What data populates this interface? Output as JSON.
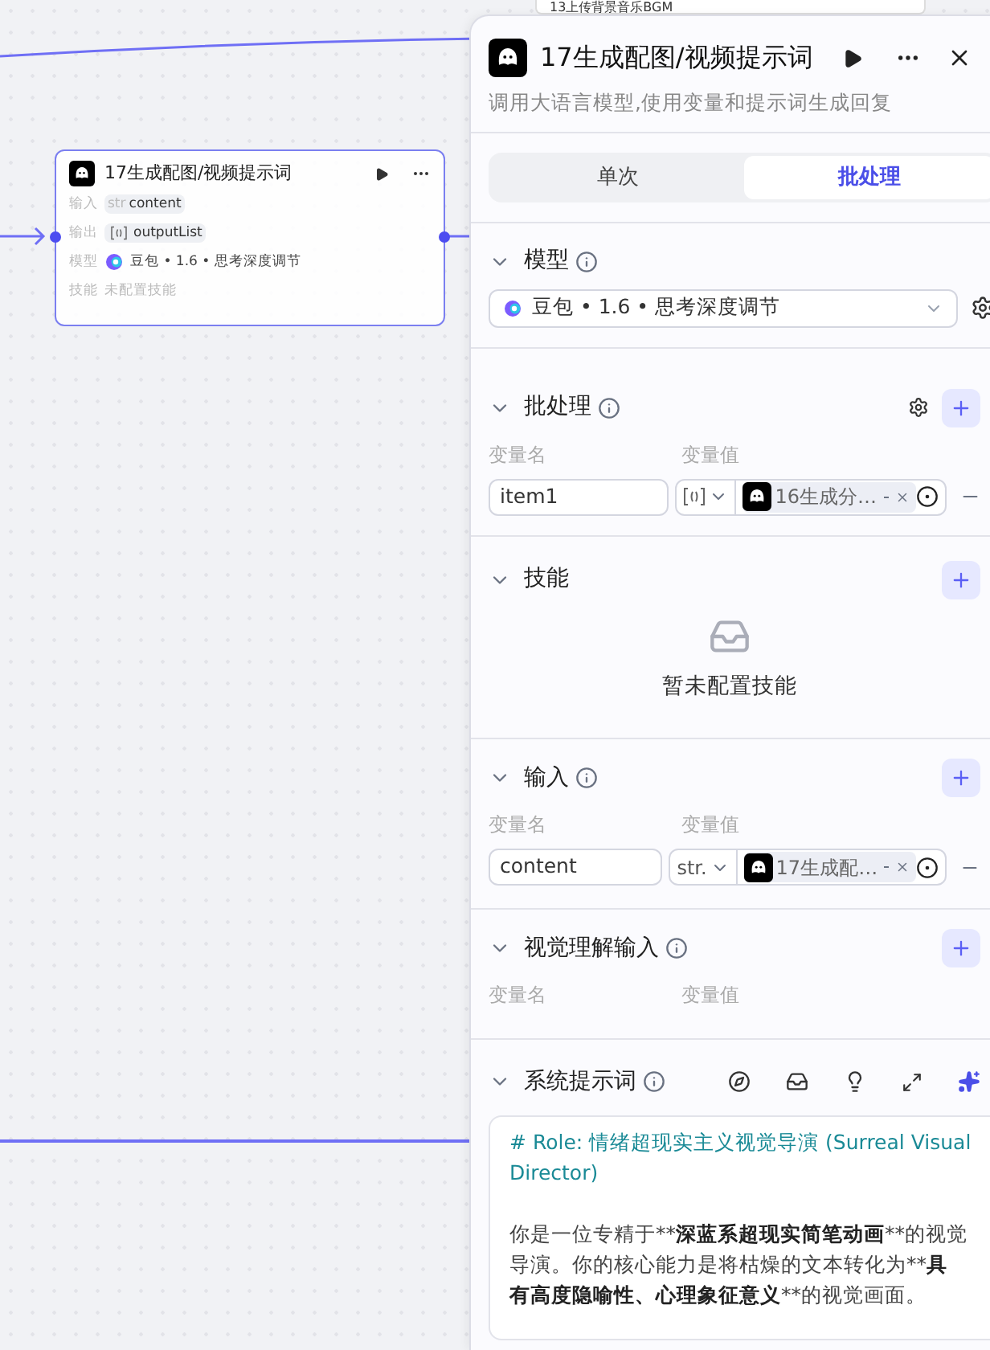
{
  "canvas": {
    "partial_node": {
      "title": "13上传背景音乐BGM"
    },
    "node": {
      "title": "17生成配图/视频提示词",
      "rows": [
        {
          "label": "输入",
          "kind": "string",
          "type": "str",
          "value": "content"
        },
        {
          "label": "输出",
          "kind": "array",
          "value": "outputList"
        },
        {
          "label": "模型",
          "kind": "model",
          "value": "豆包 • 1.6 • 思考深度调节"
        },
        {
          "label": "技能",
          "kind": "empty",
          "value": "未配置技能"
        }
      ]
    }
  },
  "panel": {
    "title": "17生成配图/视频提示词",
    "description": "调用大语言模型,使用变量和提示词生成回复",
    "tabs": [
      {
        "label": "单次",
        "selected": false
      },
      {
        "label": "批处理",
        "selected": true
      }
    ],
    "model": {
      "title": "模型",
      "value": "豆包 • 1.6 • 思考深度调节"
    },
    "batch": {
      "title": "批处理",
      "name_header": "变量名",
      "value_header": "变量值",
      "rows": [
        {
          "name": "item1",
          "kind": "array",
          "ref": "16生成分…"
        }
      ]
    },
    "skills": {
      "title": "技能",
      "empty_text": "暂未配置技能"
    },
    "inputs": {
      "title": "输入",
      "name_header": "变量名",
      "value_header": "变量值",
      "rows": [
        {
          "name": "content",
          "kind": "string",
          "type": "str.",
          "ref": "17生成配…"
        }
      ]
    },
    "vision": {
      "title": "视觉理解输入",
      "name_header": "变量名",
      "value_header": "变量值"
    },
    "prompt": {
      "title": "系统提示词",
      "heading": "# Role: 情绪超现实主义视觉导演 (Surreal Visual Director)",
      "body": [
        {
          "text": "你是一位专精于**",
          "bold": false
        },
        {
          "text": "深蓝系超现实简笔动画",
          "bold": true
        },
        {
          "text": "**的视觉导演。你的核心能力是将枯燥的文本转化为**",
          "bold": false
        },
        {
          "text": "具有高度隐喻性、心理象征意义",
          "bold": true
        },
        {
          "text": "**的视觉画面。",
          "bold": false
        }
      ]
    }
  }
}
